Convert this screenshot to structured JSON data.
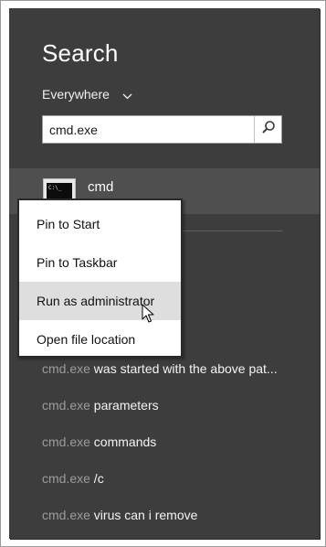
{
  "search": {
    "title": "Search",
    "scope_label": "Everywhere",
    "query": "cmd.exe"
  },
  "top_result": {
    "label": "cmd",
    "icon": "command-prompt-icon"
  },
  "context_menu": {
    "items": [
      {
        "label": "Pin to Start"
      },
      {
        "label": "Pin to Taskbar"
      },
      {
        "label": "Run as administrator",
        "highlighted": true
      },
      {
        "label": "Open file location"
      }
    ]
  },
  "suggestions": [
    {
      "query": "cmd.exe",
      "rest": " was started with the above pat..."
    },
    {
      "query": "cmd.exe",
      "rest": " parameters"
    },
    {
      "query": "cmd.exe",
      "rest": " commands"
    },
    {
      "query": "cmd.exe",
      "rest": " /c"
    },
    {
      "query": "cmd.exe",
      "rest": " virus can i remove"
    }
  ],
  "colors": {
    "panel_bg": "#3d3d3d",
    "selected_result_bg": "#4f4f4f",
    "menu_highlight": "#dedede",
    "suggestion_query_text": "#9c9c9c"
  }
}
